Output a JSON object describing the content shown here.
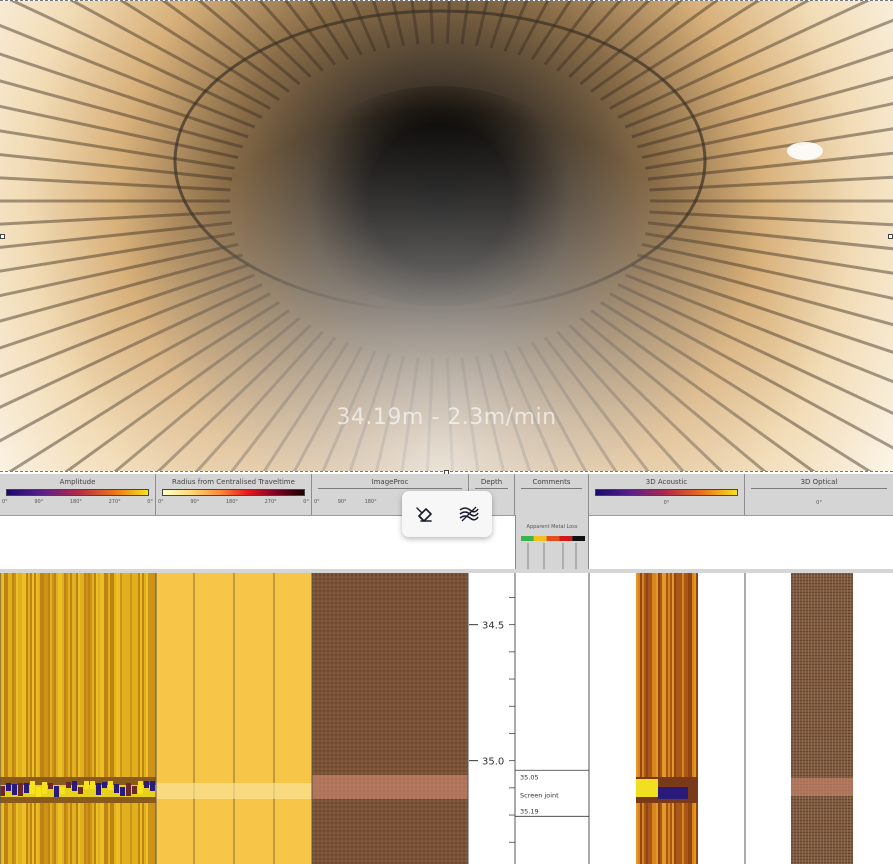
{
  "video": {
    "overlay": "34.19m - 2.3m/min"
  },
  "toolbar": {
    "erase_icon": "eraser-icon",
    "hatch_icon": "pattern-icon"
  },
  "tracks": [
    {
      "title": "Amplitude",
      "ticks": [
        "0°",
        "90°",
        "180°",
        "270°",
        "0°"
      ],
      "colormap": [
        "#1a0a6e",
        "#5a1f8a",
        "#b02a4a",
        "#e8701e",
        "#f7e21c"
      ]
    },
    {
      "title": "Radius from Centralised Traveltime",
      "ticks": [
        "0°",
        "90°",
        "180°",
        "270°",
        "0°"
      ],
      "colormap": [
        "#ffffcc",
        "#fed976",
        "#fd8d3c",
        "#e31a1c",
        "#800026",
        "#1a0000"
      ]
    },
    {
      "title": "ImageProc",
      "ticks": [
        "0°",
        "90°",
        "180°"
      ]
    },
    {
      "title": "Depth",
      "ticks": []
    },
    {
      "title": "Comments",
      "ticks": []
    },
    {
      "title": "3D Acoustic",
      "ticks": [
        "0°"
      ],
      "colormap": [
        "#1a0a6e",
        "#5a1f8a",
        "#b02a4a",
        "#e8701e",
        "#f7e21c"
      ]
    },
    {
      "title": "3D Optical",
      "ticks": [
        "0°"
      ]
    }
  ],
  "legend": {
    "title": "Apparent Metal Loss",
    "colors": [
      "#3cb44b",
      "#f0c020",
      "#e05020",
      "#d01818",
      "#111111"
    ]
  },
  "depth": {
    "labels": [
      {
        "value": "34.5",
        "depth": 34.5
      },
      {
        "value": "35.0",
        "depth": 35.0
      }
    ],
    "top_depth": 34.31,
    "bottom_depth": 35.38
  },
  "comments": {
    "start": "35.05",
    "text": "Screen joint",
    "end": "35.19"
  },
  "colors": {
    "header_bg": "#d5d5d5",
    "amplitude_base": "#d9a51a",
    "radius_base": "#f7c648",
    "imageproc_base": "#7a5236",
    "joint_band": "#c4826a"
  }
}
